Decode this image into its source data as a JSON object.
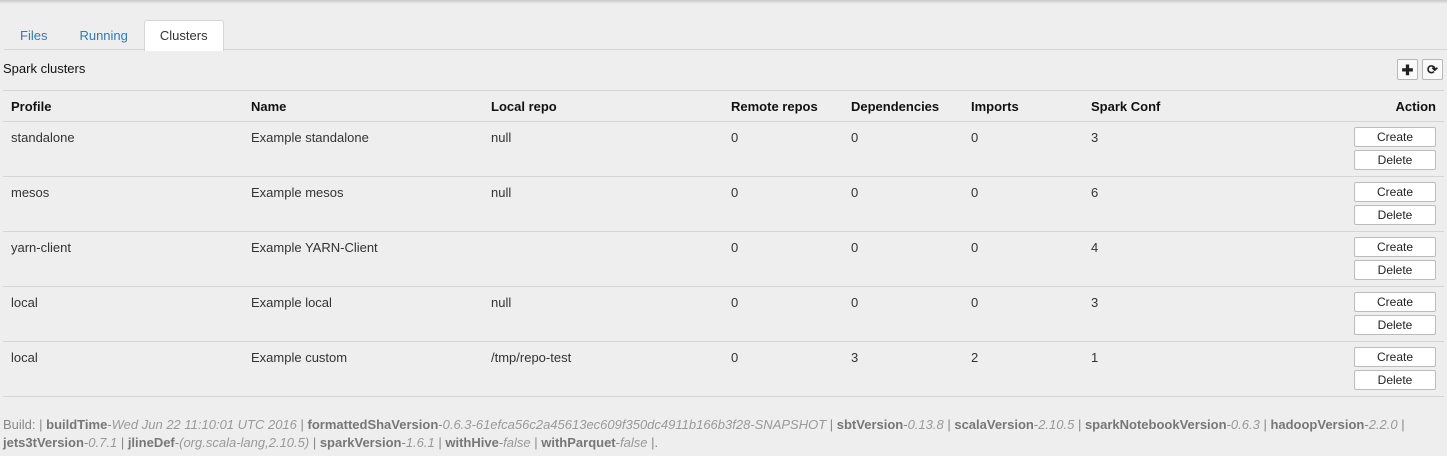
{
  "tabs": [
    {
      "label": "Files",
      "active": false
    },
    {
      "label": "Running",
      "active": false
    },
    {
      "label": "Clusters",
      "active": true
    }
  ],
  "panel": {
    "title": "Spark clusters",
    "add_icon": "plus-icon",
    "refresh_icon": "refresh-icon"
  },
  "table": {
    "headers": [
      "Profile",
      "Name",
      "Local repo",
      "Remote repos",
      "Dependencies",
      "Imports",
      "Spark Conf",
      "Action"
    ],
    "rows": [
      {
        "profile": "standalone",
        "name": "Example standalone",
        "local_repo": "null",
        "remote_repos": "0",
        "dependencies": "0",
        "imports": "0",
        "spark_conf": "3"
      },
      {
        "profile": "mesos",
        "name": "Example mesos",
        "local_repo": "null",
        "remote_repos": "0",
        "dependencies": "0",
        "imports": "0",
        "spark_conf": "6"
      },
      {
        "profile": "yarn-client",
        "name": "Example YARN-Client",
        "local_repo": "",
        "remote_repos": "0",
        "dependencies": "0",
        "imports": "0",
        "spark_conf": "4"
      },
      {
        "profile": "local",
        "name": "Example local",
        "local_repo": "null",
        "remote_repos": "0",
        "dependencies": "0",
        "imports": "0",
        "spark_conf": "3"
      },
      {
        "profile": "local",
        "name": "Example custom",
        "local_repo": "/tmp/repo-test",
        "remote_repos": "0",
        "dependencies": "3",
        "imports": "2",
        "spark_conf": "1"
      }
    ],
    "create_label": "Create",
    "delete_label": "Delete"
  },
  "build": {
    "prefix": "Build: |",
    "items": [
      {
        "key": "buildTime",
        "value": "Wed Jun 22 11:10:01 UTC 2016"
      },
      {
        "key": "formattedShaVersion",
        "value": "0.6.3-61efca56c2a45613ec609f350dc4911b166b3f28-SNAPSHOT"
      },
      {
        "key": "sbtVersion",
        "value": "0.13.8"
      },
      {
        "key": "scalaVersion",
        "value": "2.10.5"
      },
      {
        "key": "sparkNotebookVersion",
        "value": "0.6.3"
      },
      {
        "key": "hadoopVersion",
        "value": "2.2.0"
      },
      {
        "key": "jets3tVersion",
        "value": "0.7.1"
      },
      {
        "key": "jlineDef",
        "value": "(org.scala-lang,2.10.5)"
      },
      {
        "key": "sparkVersion",
        "value": "1.6.1"
      },
      {
        "key": "withHive",
        "value": "false"
      },
      {
        "key": "withParquet",
        "value": "false"
      }
    ],
    "suffix": "|."
  }
}
